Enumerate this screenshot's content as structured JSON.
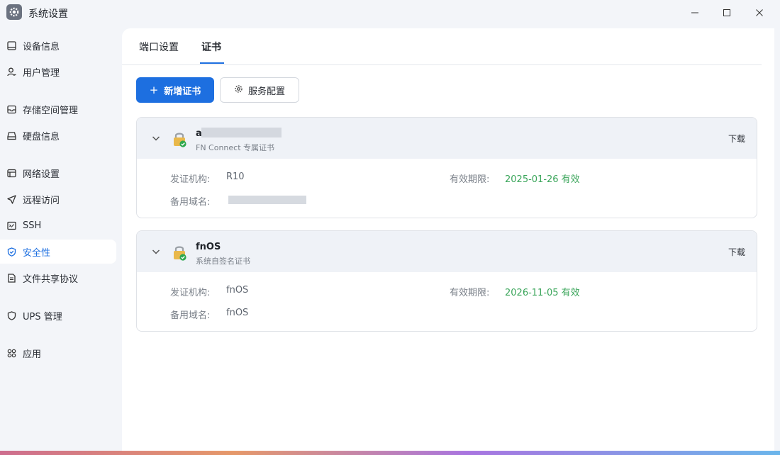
{
  "window": {
    "title": "系统设置"
  },
  "sidebar": {
    "items": [
      {
        "label": "设备信息",
        "icon": "device-icon"
      },
      {
        "label": "用户管理",
        "icon": "user-icon"
      },
      {
        "label": "存储空间管理",
        "icon": "storage-icon"
      },
      {
        "label": "硬盘信息",
        "icon": "disk-icon"
      },
      {
        "label": "网络设置",
        "icon": "network-icon"
      },
      {
        "label": "远程访问",
        "icon": "send-icon"
      },
      {
        "label": "SSH",
        "icon": "terminal-icon"
      },
      {
        "label": "安全性",
        "icon": "shield-check-icon",
        "active": true
      },
      {
        "label": "文件共享协议",
        "icon": "file-icon"
      },
      {
        "label": "UPS 管理",
        "icon": "shield-icon"
      },
      {
        "label": "应用",
        "icon": "apps-icon"
      }
    ]
  },
  "tabs": [
    {
      "label": "端口设置"
    },
    {
      "label": "证书",
      "active": true
    }
  ],
  "toolbar": {
    "add_label": "新增证书",
    "config_label": "服务配置"
  },
  "certificates": [
    {
      "name": "a",
      "subtitle": "FN Connect 专属证书",
      "download_label": "下载",
      "issuer_label": "发证机构:",
      "issuer_value": "R10",
      "validity_label": "有效期限:",
      "validity_value": "2025-01-26 有效",
      "san_label": "备用域名:",
      "san_value": ""
    },
    {
      "name": "fnOS",
      "subtitle": "系统自签名证书",
      "download_label": "下载",
      "issuer_label": "发证机构:",
      "issuer_value": "fnOS",
      "validity_label": "有效期限:",
      "validity_value": "2026-11-05 有效",
      "san_label": "备用域名:",
      "san_value": "fnOS"
    }
  ],
  "colors": {
    "accent": "#1d6fe0",
    "valid": "#3aa55a",
    "sidebar_bg": "#f3f5f9"
  }
}
